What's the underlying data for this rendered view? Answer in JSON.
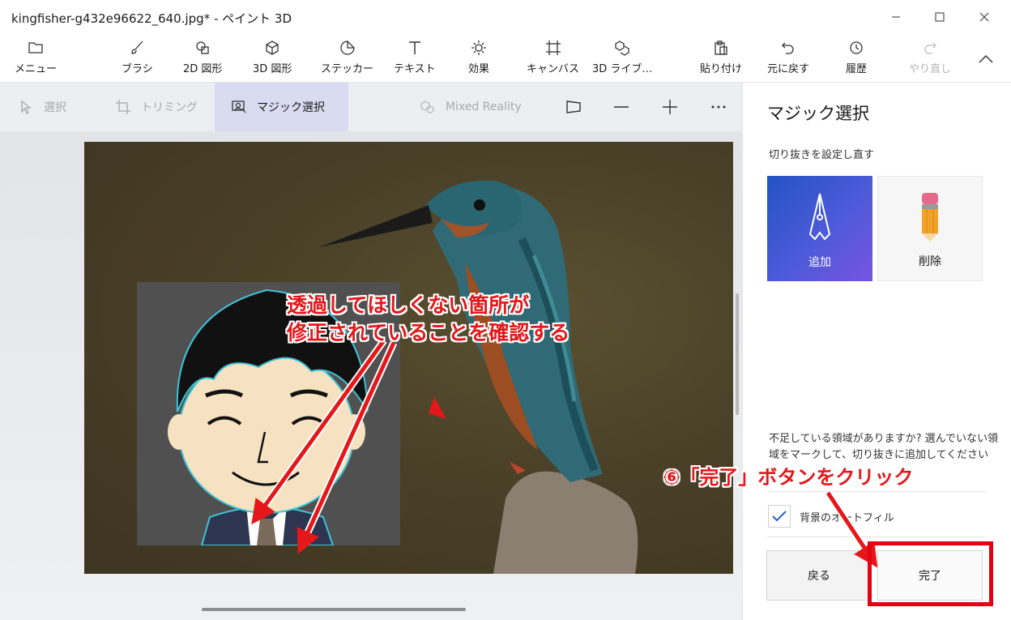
{
  "window": {
    "title": "kingfisher-g432e96622_640.jpg* - ペイント 3D"
  },
  "toolbar": {
    "menu": "メニュー",
    "brush": "ブラシ",
    "shapes2d": "2D 図形",
    "shapes3d": "3D 図形",
    "sticker": "ステッカー",
    "text": "テキスト",
    "effects": "効果",
    "canvas": "キャンバス",
    "library3d": "3D ライブ…",
    "paste": "貼り付け",
    "undo": "元に戻す",
    "history": "履歴",
    "redo": "やり直し"
  },
  "subbar": {
    "select": "選択",
    "crop": "トリミング",
    "magic_select": "マジック選択",
    "mixed_reality": "Mixed Reality"
  },
  "canvas": {
    "callout_line1": "透過してほしくない箇所が",
    "callout_line2": "修正されていることを確認する",
    "step_label": "⑥「完了」ボタンをクリック"
  },
  "panel": {
    "title": "マジック選択",
    "subtitle": "切り抜きを設定し直す",
    "add_label": "追加",
    "remove_label": "削除",
    "help_text": "不足している領域がありますか? 選んでいない領域をマークして、切り抜きに追加してください",
    "autofill_label": "背景のオートフィル",
    "autofill_checked": true,
    "back_label": "戻る",
    "done_label": "完了"
  },
  "colors": {
    "accent": "#2b5fd0",
    "annotation_red": "#e4181b"
  }
}
